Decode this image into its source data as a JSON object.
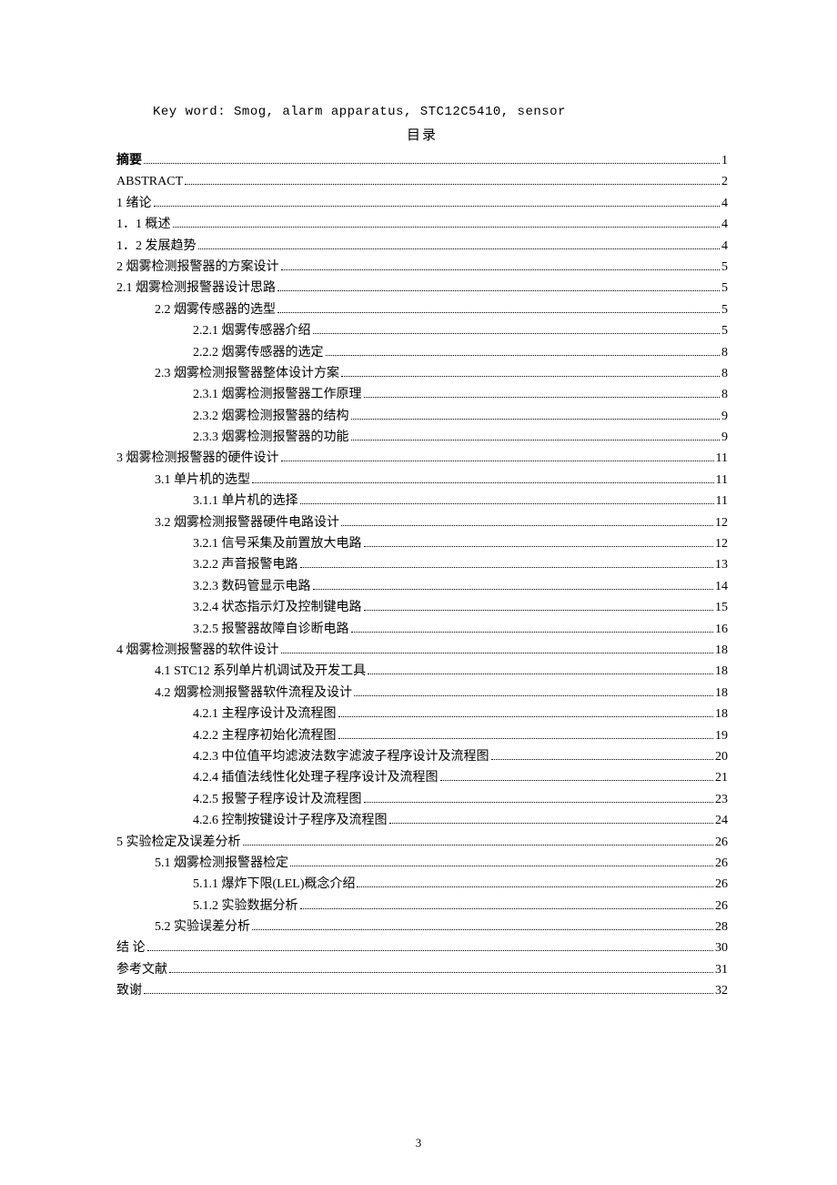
{
  "keywords_line": "Key word: Smog, alarm apparatus, STC12C5410, sensor",
  "toc_title": "目录",
  "page_number": "3",
  "toc": [
    {
      "indent": 0,
      "bold": true,
      "label": "摘要",
      "page": "1"
    },
    {
      "indent": 0,
      "bold": false,
      "label": "ABSTRACT",
      "page": "2"
    },
    {
      "indent": 0,
      "bold": false,
      "label": "1 绪论",
      "page": "4"
    },
    {
      "indent": 0,
      "bold": false,
      "label": "1．1 概述",
      "page": "4"
    },
    {
      "indent": 0,
      "bold": false,
      "label": "1．2 发展趋势",
      "page": "4"
    },
    {
      "indent": 0,
      "bold": false,
      "label": "2 烟雾检测报警器的方案设计",
      "page": "5"
    },
    {
      "indent": 0,
      "bold": false,
      "label": "2.1 烟雾检测报警器设计思路",
      "page": "5"
    },
    {
      "indent": 1,
      "bold": false,
      "label": "2.2 烟雾传感器的选型",
      "page": "5"
    },
    {
      "indent": 2,
      "bold": false,
      "label": "2.2.1 烟雾传感器介绍",
      "page": "5"
    },
    {
      "indent": 2,
      "bold": false,
      "label": "2.2.2 烟雾传感器的选定",
      "page": "8"
    },
    {
      "indent": 1,
      "bold": false,
      "label": "2.3 烟雾检测报警器整体设计方案",
      "page": "8"
    },
    {
      "indent": 2,
      "bold": false,
      "label": "2.3.1 烟雾检测报警器工作原理",
      "page": "8"
    },
    {
      "indent": 2,
      "bold": false,
      "label": "2.3.2 烟雾检测报警器的结构",
      "page": "9"
    },
    {
      "indent": 2,
      "bold": false,
      "label": "2.3.3 烟雾检测报警器的功能",
      "page": "9"
    },
    {
      "indent": 0,
      "bold": false,
      "label": "3 烟雾检测报警器的硬件设计",
      "page": "11"
    },
    {
      "indent": 1,
      "bold": false,
      "label": "3.1 单片机的选型",
      "page": "11"
    },
    {
      "indent": 2,
      "bold": false,
      "label": "3.1.1 单片机的选择",
      "page": "11"
    },
    {
      "indent": 1,
      "bold": false,
      "label": "3.2 烟雾检测报警器硬件电路设计",
      "page": "12"
    },
    {
      "indent": 2,
      "bold": false,
      "label": "3.2.1 信号采集及前置放大电路",
      "page": "12"
    },
    {
      "indent": 2,
      "bold": false,
      "label": "3.2.2 声音报警电路",
      "page": "13"
    },
    {
      "indent": 2,
      "bold": false,
      "label": "3.2.3 数码管显示电路",
      "page": "14"
    },
    {
      "indent": 2,
      "bold": false,
      "label": "3.2.4 状态指示灯及控制键电路",
      "page": "15"
    },
    {
      "indent": 2,
      "bold": false,
      "label": "3.2.5 报警器故障自诊断电路",
      "page": "16"
    },
    {
      "indent": 0,
      "bold": false,
      "label": "4 烟雾检测报警器的软件设计",
      "page": "18"
    },
    {
      "indent": 1,
      "bold": false,
      "label": "4.1 STC12 系列单片机调试及开发工具",
      "page": "18"
    },
    {
      "indent": 1,
      "bold": false,
      "label": "4.2 烟雾检测报警器软件流程及设计",
      "page": "18"
    },
    {
      "indent": 2,
      "bold": false,
      "label": "4.2.1 主程序设计及流程图",
      "page": "18"
    },
    {
      "indent": 2,
      "bold": false,
      "label": "4.2.2 主程序初始化流程图",
      "page": "19"
    },
    {
      "indent": 2,
      "bold": false,
      "label": "4.2.3 中位值平均滤波法数字滤波子程序设计及流程图",
      "page": "20"
    },
    {
      "indent": 2,
      "bold": false,
      "label": "4.2.4 插值法线性化处理子程序设计及流程图",
      "page": "21"
    },
    {
      "indent": 2,
      "bold": false,
      "label": "4.2.5 报警子程序设计及流程图",
      "page": "23"
    },
    {
      "indent": 2,
      "bold": false,
      "label": "4.2.6 控制按键设计子程序及流程图",
      "page": "24"
    },
    {
      "indent": 0,
      "bold": false,
      "label": "5 实验检定及误差分析",
      "page": "26"
    },
    {
      "indent": 1,
      "bold": false,
      "label": "5.1 烟雾检测报警器检定",
      "page": "26"
    },
    {
      "indent": 2,
      "bold": false,
      "label": "5.1.1 爆炸下限(LEL)概念介绍",
      "page": "26"
    },
    {
      "indent": 2,
      "bold": false,
      "label": "5.1.2 实验数据分析",
      "page": "26"
    },
    {
      "indent": 1,
      "bold": false,
      "label": "5.2 实验误差分析",
      "page": "28"
    },
    {
      "indent": 0,
      "bold": false,
      "label": "结 论",
      "page": "30"
    },
    {
      "indent": 0,
      "bold": false,
      "label": "参考文献",
      "page": "31"
    },
    {
      "indent": 0,
      "bold": false,
      "label": "致谢",
      "page": "32"
    }
  ]
}
